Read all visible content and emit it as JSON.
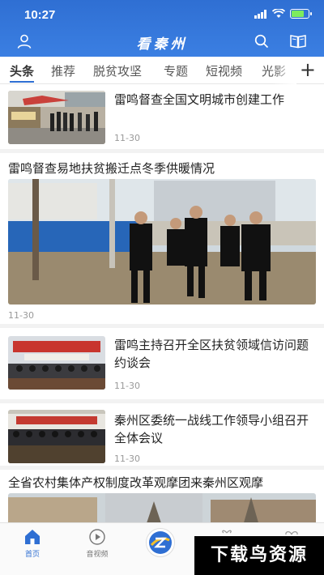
{
  "status_bar": {
    "time": "10:27"
  },
  "header": {
    "title": "看秦州"
  },
  "tabs": [
    "头条",
    "推荐",
    "脱贫攻坚",
    "专题",
    "短视频",
    "光影"
  ],
  "feed": {
    "item1": {
      "title": "雷鸣督查全国文明城市创建工作",
      "date": "11-30"
    },
    "item2": {
      "title": "雷鸣督查易地扶贫搬迁点冬季供暖情况",
      "date": "11-30"
    },
    "item3": {
      "title": "雷鸣主持召开全区扶贫领域信访问题约谈会",
      "date": "11-30"
    },
    "item4": {
      "title": "秦州区委统一战线工作领导小组召开全体会议",
      "date": "11-30"
    },
    "item5": {
      "title": "全省农村集体产权制度改革观摩团来秦州区观摩"
    }
  },
  "bottom_nav": {
    "home": "首页",
    "video": "音视频"
  },
  "watermark": "下载鸟资源",
  "colors": {
    "brand_blue": "#2f6fd3",
    "divider": "#f2f2f2"
  }
}
